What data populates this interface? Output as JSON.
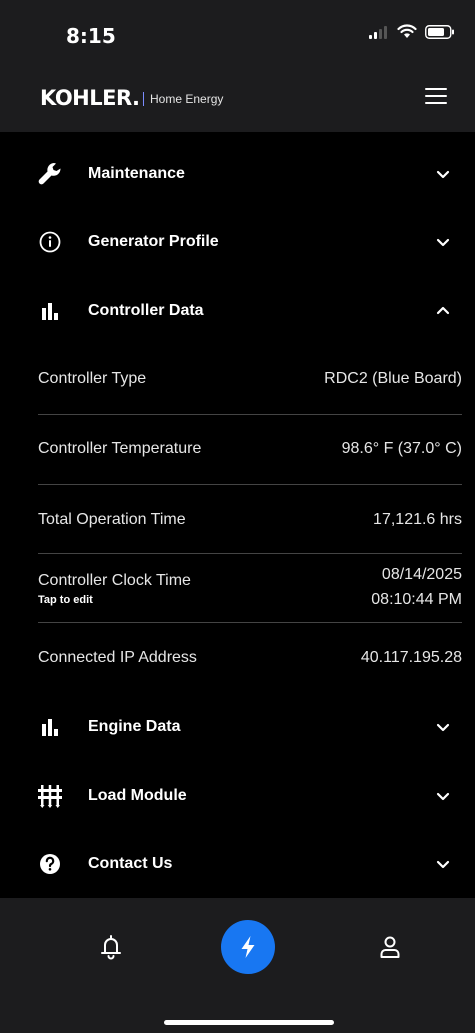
{
  "status_bar": {
    "time": "8:15"
  },
  "header": {
    "logo": "KOHLER.",
    "subtitle": "Home Energy",
    "menu_icon": "hamburger-icon"
  },
  "sections": {
    "maintenance": {
      "label": "Maintenance",
      "icon": "wrench-icon",
      "expanded": false
    },
    "generator_profile": {
      "label": "Generator Profile",
      "icon": "info-icon",
      "expanded": false
    },
    "controller_data": {
      "label": "Controller Data",
      "icon": "bar-chart-icon",
      "expanded": true
    },
    "engine_data": {
      "label": "Engine Data",
      "icon": "bar-chart-icon",
      "expanded": false
    },
    "load_module": {
      "label": "Load Module",
      "icon": "load-module-icon",
      "expanded": false
    },
    "contact_us": {
      "label": "Contact Us",
      "icon": "help-circle-icon",
      "expanded": false
    }
  },
  "controller_rows": [
    {
      "label": "Controller Type",
      "value": "RDC2 (Blue Board)"
    },
    {
      "label": "Controller Temperature",
      "value": "98.6° F (37.0° C)"
    },
    {
      "label": "Total Operation Time",
      "value": "17,121.6 hrs"
    },
    {
      "label": "Controller Clock Time",
      "sub": "Tap to edit",
      "date": "08/14/2025",
      "time": "08:10:44 PM"
    },
    {
      "label": "Connected IP Address",
      "value": "40.117.195.28"
    }
  ],
  "tabbar": {
    "items": [
      {
        "icon": "bell-icon",
        "active": false
      },
      {
        "icon": "lightning-icon",
        "active": true
      },
      {
        "icon": "user-icon",
        "active": false
      }
    ]
  },
  "colors": {
    "accent": "#1877f2",
    "bar_background": "#1c1c1e",
    "background": "#000000",
    "divider": "#444444"
  }
}
